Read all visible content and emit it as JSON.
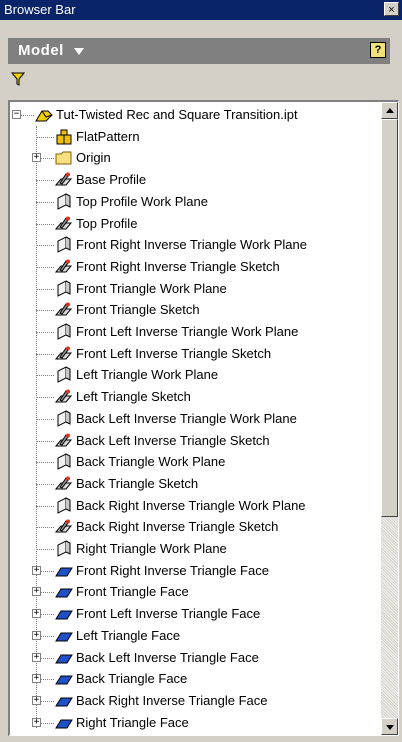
{
  "window": {
    "title": "Browser Bar",
    "close_glyph": "×"
  },
  "toolbar": {
    "model_label": "Model",
    "help_glyph": "?"
  },
  "icons": {
    "filter": "filter-icon",
    "help": "help-icon"
  },
  "tree": {
    "items": [
      {
        "label": "Tut-Twisted Rec and Square Transition.ipt",
        "icon": "part-icon",
        "level": 0,
        "expander": "−"
      },
      {
        "label": "FlatPattern",
        "icon": "flatpattern-icon",
        "level": 1,
        "expander": ""
      },
      {
        "label": "Origin",
        "icon": "folder-icon",
        "level": 1,
        "expander": "+"
      },
      {
        "label": "Base Profile",
        "icon": "sketch-icon",
        "level": 1,
        "expander": ""
      },
      {
        "label": "Top Profile Work Plane",
        "icon": "workplane-icon",
        "level": 1,
        "expander": ""
      },
      {
        "label": "Top Profile",
        "icon": "sketch-icon",
        "level": 1,
        "expander": ""
      },
      {
        "label": "Front Right Inverse Triangle Work Plane",
        "icon": "workplane-icon",
        "level": 1,
        "expander": ""
      },
      {
        "label": "Front Right Inverse Triangle Sketch",
        "icon": "sketch-icon",
        "level": 1,
        "expander": ""
      },
      {
        "label": "Front Triangle Work Plane",
        "icon": "workplane-icon",
        "level": 1,
        "expander": ""
      },
      {
        "label": "Front Triangle Sketch",
        "icon": "sketch-icon",
        "level": 1,
        "expander": ""
      },
      {
        "label": "Front Left Inverse Triangle Work Plane",
        "icon": "workplane-icon",
        "level": 1,
        "expander": ""
      },
      {
        "label": "Front Left Inverse Triangle Sketch",
        "icon": "sketch-icon",
        "level": 1,
        "expander": ""
      },
      {
        "label": "Left Triangle Work Plane",
        "icon": "workplane-icon",
        "level": 1,
        "expander": ""
      },
      {
        "label": "Left Triangle Sketch",
        "icon": "sketch-icon",
        "level": 1,
        "expander": ""
      },
      {
        "label": "Back Left Inverse Triangle Work Plane",
        "icon": "workplane-icon",
        "level": 1,
        "expander": ""
      },
      {
        "label": "Back Left Inverse Triangle Sketch",
        "icon": "sketch-icon",
        "level": 1,
        "expander": ""
      },
      {
        "label": "Back Triangle Work Plane",
        "icon": "workplane-icon",
        "level": 1,
        "expander": ""
      },
      {
        "label": "Back Triangle Sketch",
        "icon": "sketch-icon",
        "level": 1,
        "expander": ""
      },
      {
        "label": "Back Right Inverse Triangle Work Plane",
        "icon": "workplane-icon",
        "level": 1,
        "expander": ""
      },
      {
        "label": "Back Right Inverse Triangle Sketch",
        "icon": "sketch-icon",
        "level": 1,
        "expander": ""
      },
      {
        "label": "Right Triangle Work Plane",
        "icon": "workplane-icon",
        "level": 1,
        "expander": ""
      },
      {
        "label": "Front Right Inverse Triangle Face",
        "icon": "face-icon",
        "level": 1,
        "expander": "+"
      },
      {
        "label": "Front Triangle Face",
        "icon": "face-icon",
        "level": 1,
        "expander": "+"
      },
      {
        "label": "Front Left Inverse Triangle Face",
        "icon": "face-icon",
        "level": 1,
        "expander": "+"
      },
      {
        "label": "Left Triangle Face",
        "icon": "face-icon",
        "level": 1,
        "expander": "+"
      },
      {
        "label": "Back Left Inverse Triangle Face",
        "icon": "face-icon",
        "level": 1,
        "expander": "+"
      },
      {
        "label": "Back Triangle Face",
        "icon": "face-icon",
        "level": 1,
        "expander": "+"
      },
      {
        "label": "Back Right Inverse Triangle Face",
        "icon": "face-icon",
        "level": 1,
        "expander": "+"
      },
      {
        "label": "Right Triangle Face",
        "icon": "face-icon",
        "level": 1,
        "expander": "+"
      }
    ]
  },
  "colors": {
    "titlebar": "#0a246a",
    "toolbar": "#808080",
    "face_blue": "#2050c8",
    "filter_yellow": "#f0d000"
  }
}
